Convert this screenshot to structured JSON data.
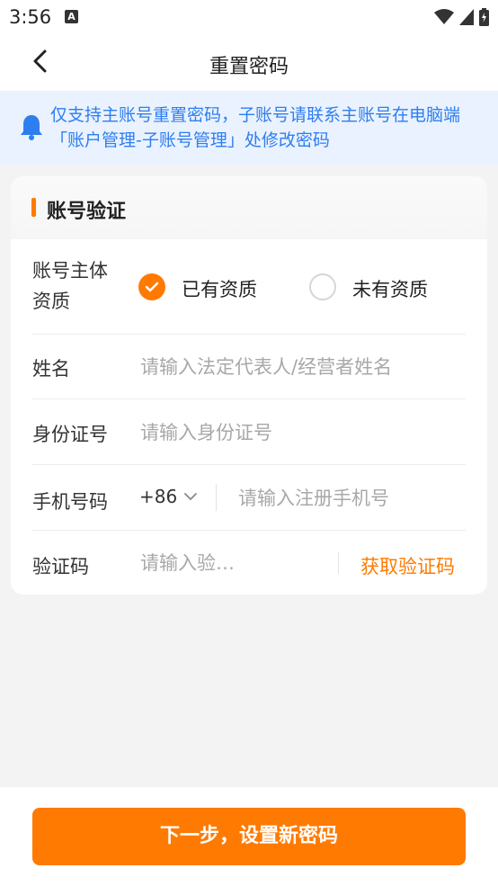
{
  "status_bar": {
    "time": "3:56",
    "notification_icon": "a-badge-icon"
  },
  "nav": {
    "title": "重置密码"
  },
  "notice": {
    "text": "仅支持主账号重置密码，子账号请联系主账号在电脑端「账户管理-子账号管理」处修改密码",
    "icon": "bell-icon"
  },
  "card": {
    "title": "账号验证",
    "qualification": {
      "label_line1": "账号主体",
      "label_line2": "资质",
      "options": [
        {
          "label": "已有资质",
          "selected": true
        },
        {
          "label": "未有资质",
          "selected": false
        }
      ]
    },
    "name": {
      "label": "姓名",
      "placeholder": "请输入法定代表人/经营者姓名"
    },
    "id_number": {
      "label": "身份证号",
      "placeholder": "请输入身份证号"
    },
    "phone": {
      "label": "手机号码",
      "country_code": "+86",
      "placeholder": "请输入注册手机号"
    },
    "verify_code": {
      "label": "验证码",
      "placeholder": "请输入验…",
      "get_code_label": "获取验证码"
    }
  },
  "next_button": {
    "label": "下一步，设置新密码"
  },
  "colors": {
    "accent": "#ff7a00",
    "notice_text": "#2f7ef0",
    "notice_bg": "#e9f2fe"
  }
}
